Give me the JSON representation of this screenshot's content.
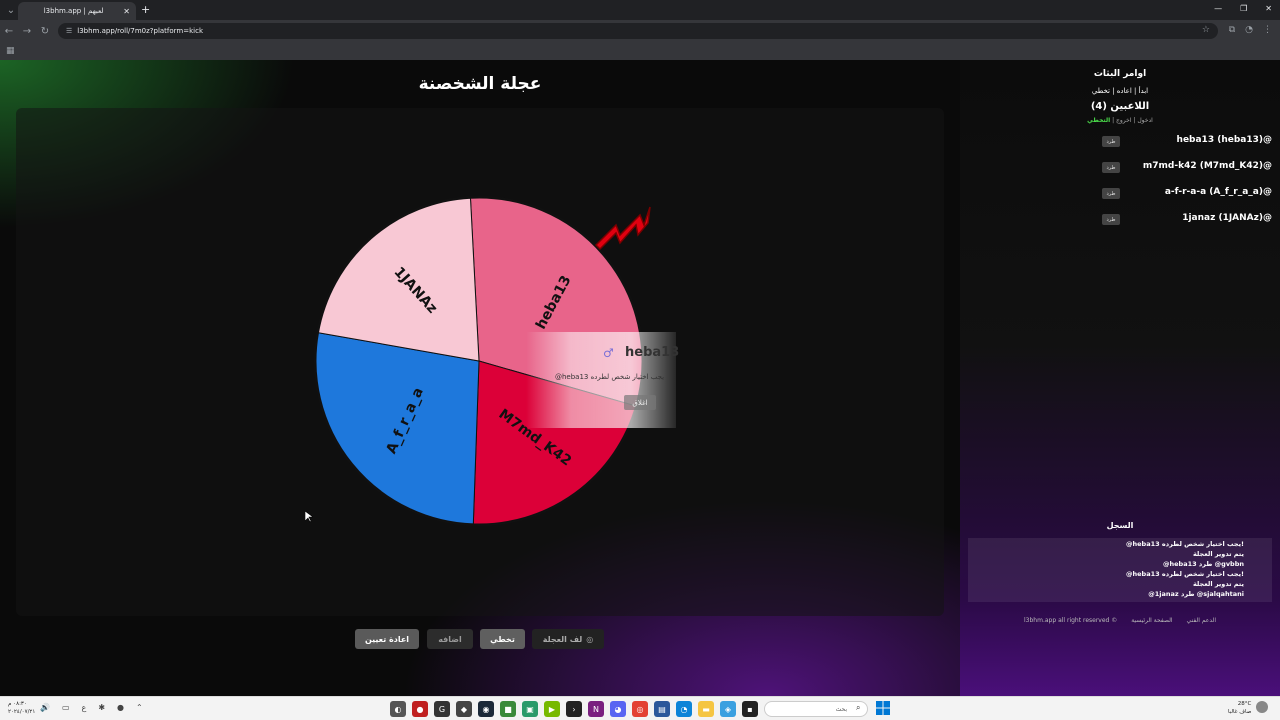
{
  "browser": {
    "tab_title": "l3bhm.app | لعبهم",
    "url": "l3bhm.app/roll/7m0z?platform=kick",
    "new_tab": "+",
    "close": "✕"
  },
  "page": {
    "title": "عجلة الشخصنة"
  },
  "wheel": {
    "segments": [
      {
        "label": "heba13",
        "color": "#e8648a"
      },
      {
        "label": "M7md_K42",
        "color": "#dc0038"
      },
      {
        "label": "A_f_r_a_a",
        "color": "#1e78dc"
      },
      {
        "label": "1JANAz",
        "color": "#f8c8d4"
      }
    ]
  },
  "popup": {
    "name": "heba13",
    "message": "@heba13 يجب اختيار شخص لطرده",
    "close_label": "اغلاق"
  },
  "controls": {
    "reset_label": "اعادة تعيين",
    "add_label": "اضافه",
    "skip_label": "تخطي",
    "spin_label": "لف العجلة"
  },
  "panel": {
    "title": "اوامر البثات",
    "subtitle": "ابدأ | اعاده | تخطي",
    "players_title": "اللاعبين (4)",
    "status_enter": "ادخول",
    "status_exit": "اخروج",
    "status_skip": "التخطي",
    "kick_label": "طرد",
    "players": [
      "heba13 (heba13)@",
      "m7md-k42 (M7md_K42)@",
      "a-f-r-a-a (A_f_r_a_a)@",
      "1janaz (1JANAz)@"
    ],
    "log_title": "السجل",
    "log": [
      "@heba13 يجب اختيار شخص لطرده!",
      "يتم تدوير العجلة",
      "@heba13 طرد @gvbbn",
      "@heba13 يجب اختيار شخص لطرده!",
      "يتم تدوير العجلة",
      "@1janaz طرد @sjalqahtani"
    ],
    "footer": {
      "copyright": "l3bhm.app all right reserved ©",
      "support": "الدعم الفني",
      "home": "الصفحة الرئيسية"
    }
  },
  "taskbar": {
    "time": "٠٨:٣٠ م",
    "date": "٢٠٢٤/٠٧/٢١",
    "lang": "ع",
    "search_placeholder": "بحث",
    "weather_temp": "28°C",
    "weather_desc": "صاف غالبا"
  }
}
